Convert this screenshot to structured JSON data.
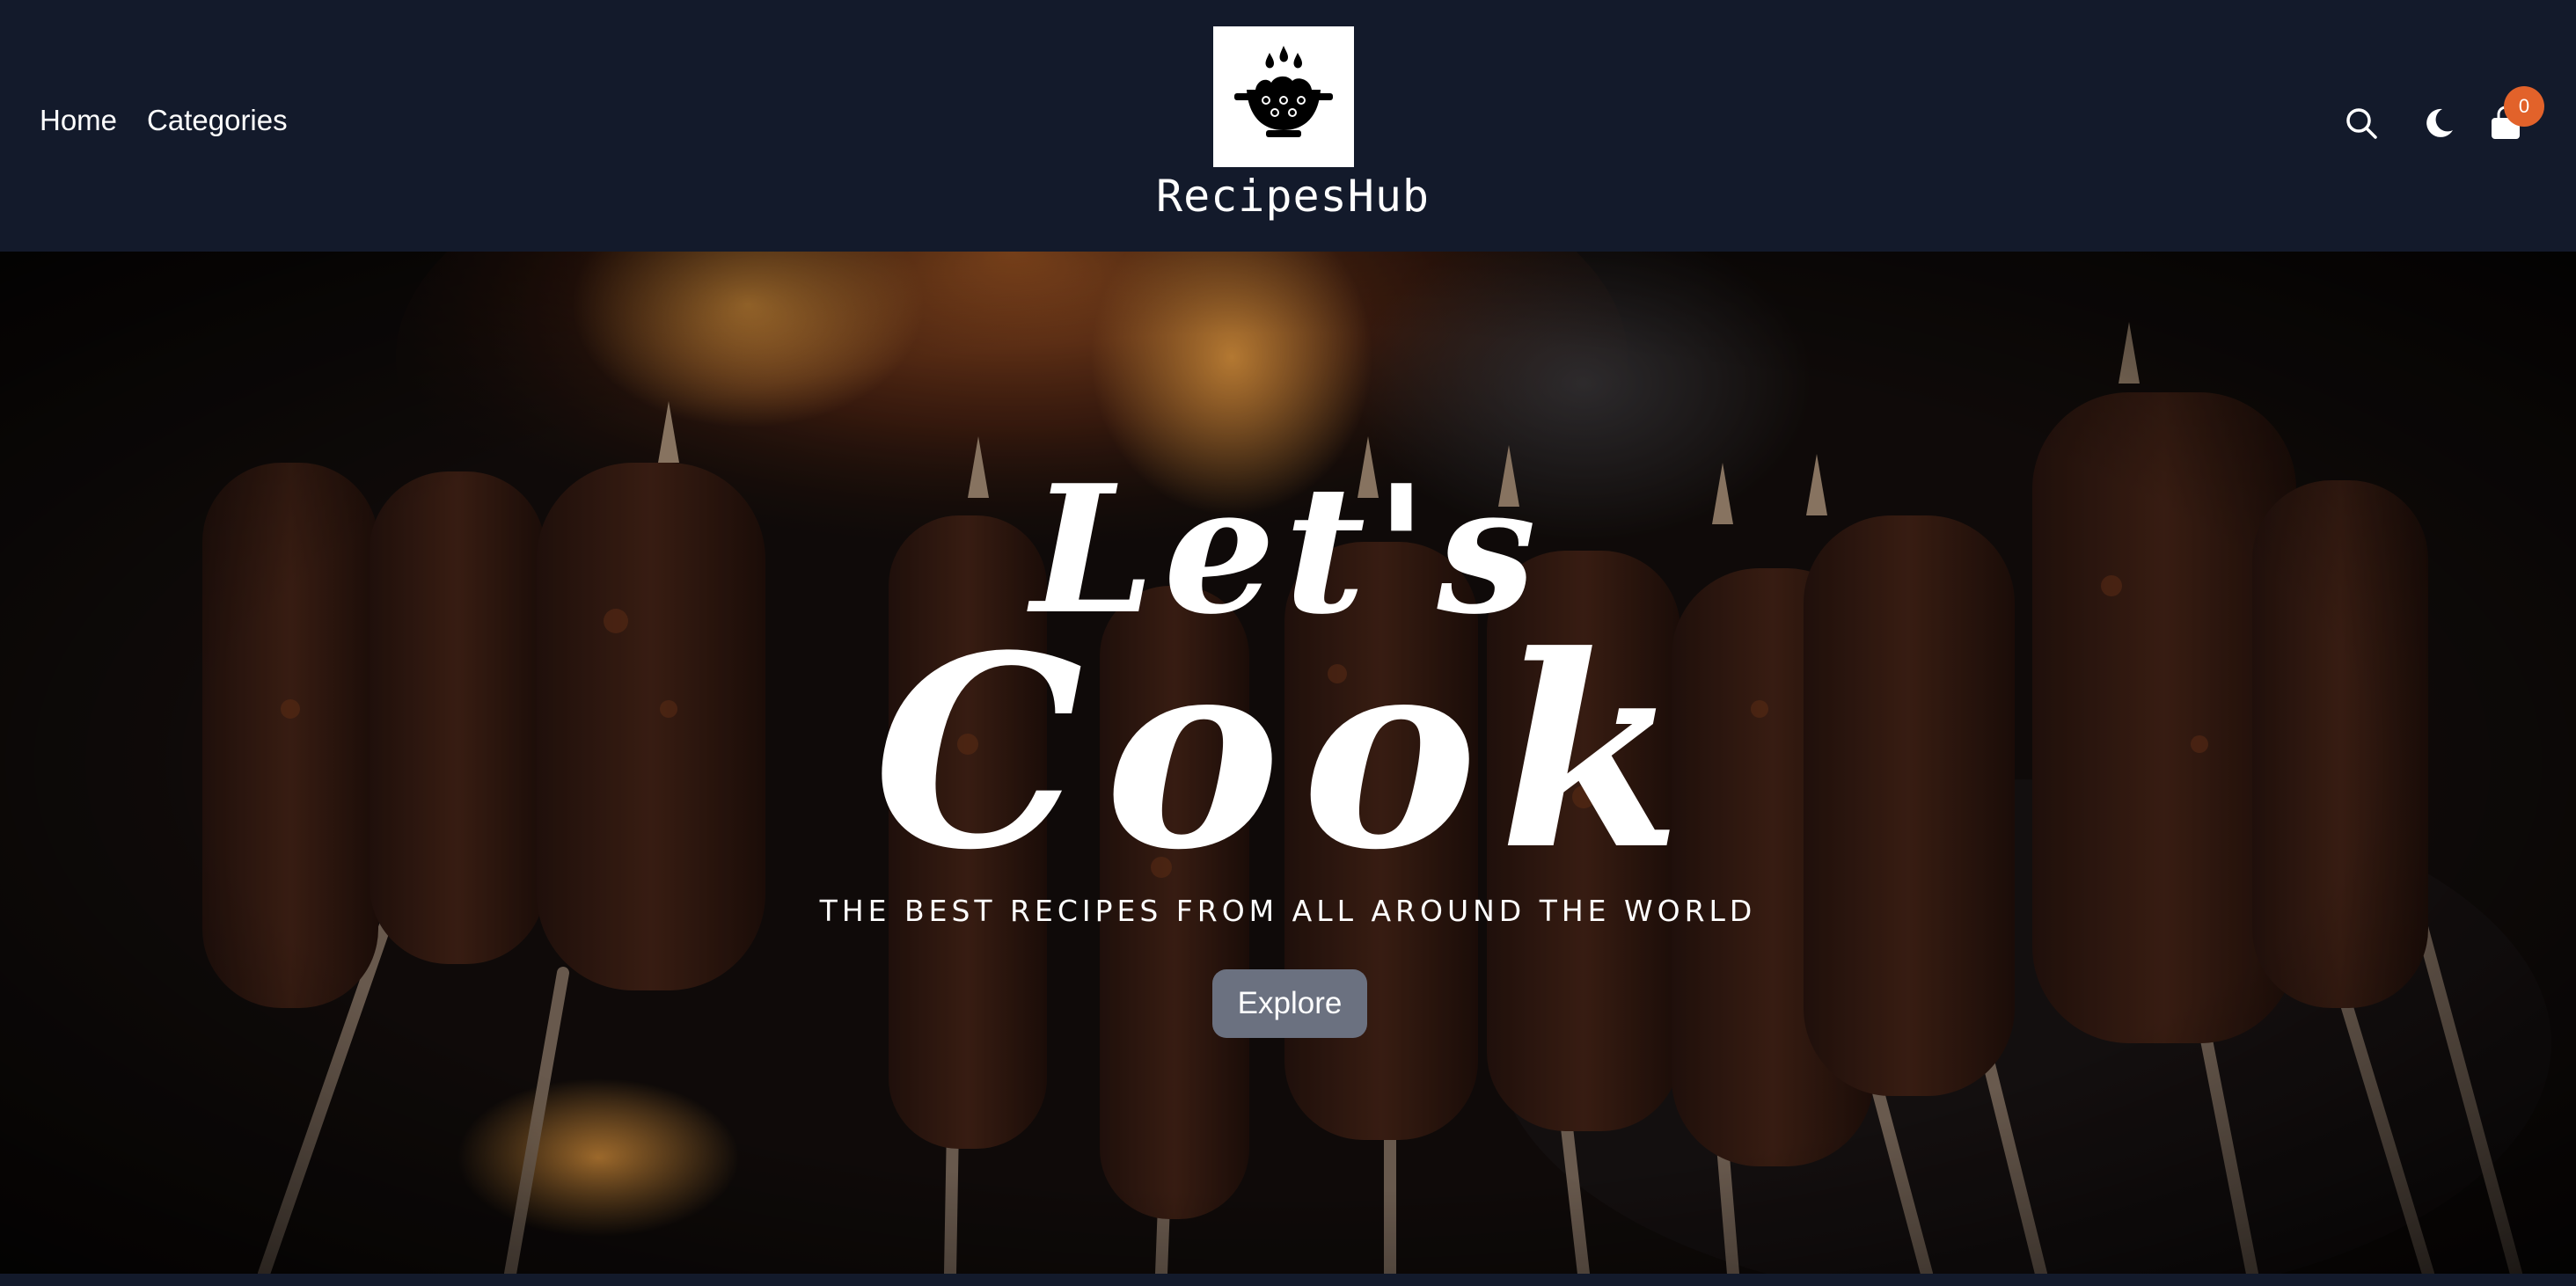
{
  "nav": {
    "links": [
      "Home",
      "Categories"
    ],
    "icons": [
      "search-icon",
      "moon-icon",
      "shopping-bag-icon"
    ],
    "cart_count": "0"
  },
  "brand": {
    "name": "RecipesHub",
    "logo_icon": "cooking-pot-icon"
  },
  "hero": {
    "title_line1": "Let's",
    "title_line2": "Cook",
    "subtitle": "THE BEST RECIPES FROM ALL AROUND THE WORLD",
    "button_label": "Explore",
    "background": "grilled-skewers-over-fire-photo"
  },
  "colors": {
    "navbar_bg": "#131a2b",
    "badge": "#e2622a",
    "button_bg": "#6b7180"
  }
}
